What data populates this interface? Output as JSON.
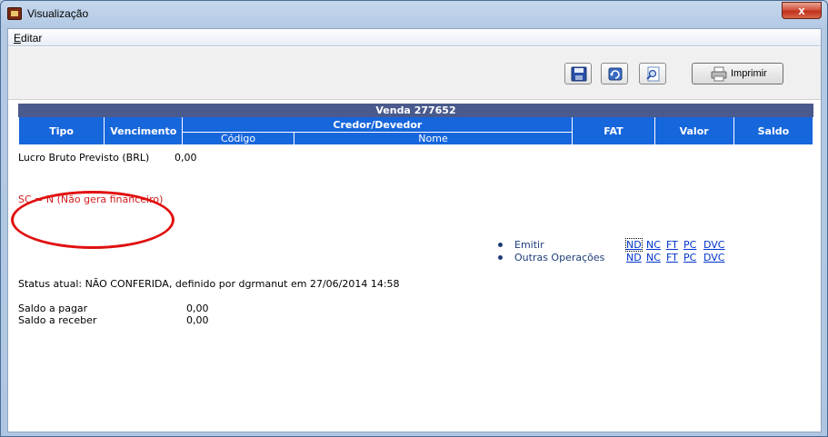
{
  "window": {
    "title": "Visualização",
    "close_label": "x"
  },
  "menu": {
    "editar_underlined": "E",
    "editar_rest": "ditar"
  },
  "toolbar": {
    "buttons": [
      "save-icon",
      "refresh-icon",
      "search-icon"
    ],
    "print_label": "Imprimir"
  },
  "table": {
    "title": "Venda  277652",
    "headers": {
      "tipo": "Tipo",
      "vencimento": "Vencimento",
      "credor_devedor": "Credor/Devedor",
      "codigo": "Código",
      "nome": "Nome",
      "fat": "FAT",
      "valor": "Valor",
      "saldo": "Saldo"
    },
    "header_color": "#1666dc",
    "title_color": "#4a5a8c"
  },
  "summary": {
    "lucro_label": "Lucro Bruto Previsto (BRL)",
    "lucro_value": "0,00",
    "sc_note": "SC = N (Não gera financeiro)",
    "status": "Status atual: NÃO CONFERIDA, definido por dgrmanut em 27/06/2014 14:58",
    "saldo_pagar_label": "Saldo a pagar",
    "saldo_pagar_value": "0,00",
    "saldo_receber_label": "Saldo a receber",
    "saldo_receber_value": "0,00"
  },
  "operations": {
    "emitir": {
      "label": "Emitir",
      "links": [
        "ND",
        "NC",
        "FT",
        "PC",
        "DVC"
      ]
    },
    "outras": {
      "label": "Outras Operações",
      "links": [
        "ND",
        "NC",
        "FT",
        "PC",
        "DVC"
      ]
    }
  },
  "annotation_color": "#e01010"
}
